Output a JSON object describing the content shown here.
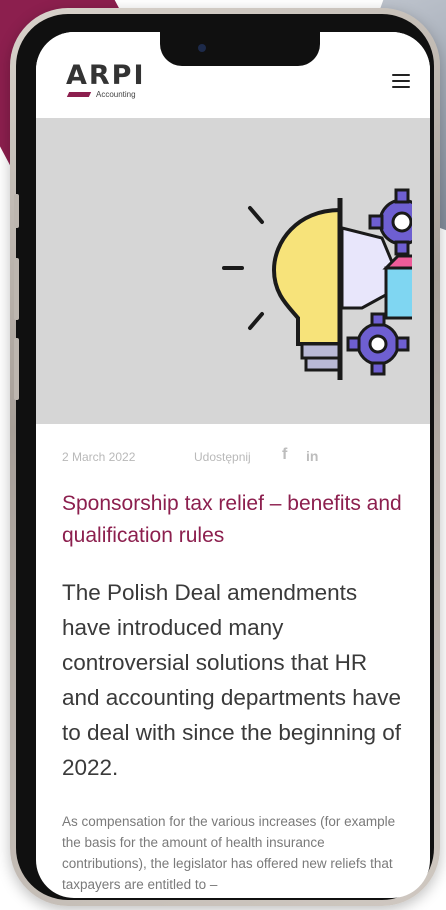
{
  "brand": {
    "logo_text": "ARPI",
    "logo_subtitle": "Accounting",
    "accent": "#8c1f4e"
  },
  "header": {
    "menu_icon": "hamburger-menu-icon"
  },
  "hero": {
    "illustration": "lightbulb-gears-illustration"
  },
  "article": {
    "date": "2 March 2022",
    "share_label": "Udostępnij",
    "share_icons": [
      "facebook-icon",
      "linkedin-icon"
    ],
    "share_fb": "f",
    "share_in": "in",
    "title": "Sponsorship tax relief – benefits and qualification rules",
    "lead": "The Polish Deal amendments have introduced many controversial solutions that HR and accounting departments have to deal with since the beginning of 2022.",
    "body": "As compensation for the various increases (for example the basis for the amount of health insurance contributions), the legislator has offered new reliefs that taxpayers are entitled to –"
  },
  "colors": {
    "title": "#8c1f4e",
    "hero_bg": "#d6d6d6",
    "text": "#3a3a3a",
    "muted": "#b9b9b9"
  }
}
